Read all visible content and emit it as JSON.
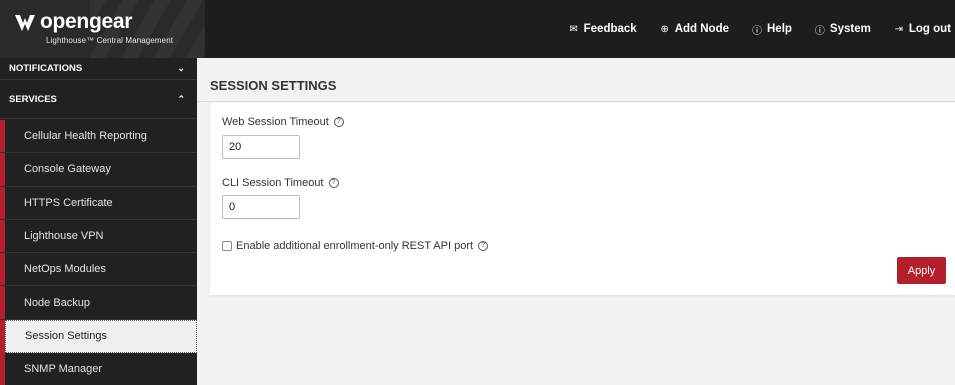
{
  "brand": {
    "name": "opengear",
    "subtitle": "Lighthouse™ Central Management"
  },
  "topnav": [
    {
      "label": "Feedback",
      "icon": "envelope-icon"
    },
    {
      "label": "Add Node",
      "icon": "plus-circle-icon"
    },
    {
      "label": "Help",
      "icon": "help-circle-icon"
    },
    {
      "label": "System",
      "icon": "info-circle-icon"
    },
    {
      "label": "Log out",
      "icon": "logout-icon"
    }
  ],
  "sidebar": {
    "notifications": "NOTIFICATIONS",
    "services": "SERVICES",
    "items": [
      {
        "label": "Cellular Health Reporting"
      },
      {
        "label": "Console Gateway"
      },
      {
        "label": "HTTPS Certificate"
      },
      {
        "label": "Lighthouse VPN"
      },
      {
        "label": "NetOps Modules"
      },
      {
        "label": "Node Backup"
      },
      {
        "label": "Session Settings",
        "active": true
      },
      {
        "label": "SNMP Manager"
      }
    ]
  },
  "page": {
    "title": "SESSION SETTINGS",
    "web_timeout_label": "Web Session Timeout",
    "web_timeout_value": "20",
    "cli_timeout_label": "CLI Session Timeout",
    "cli_timeout_value": "0",
    "rest_api_label": "Enable additional enrollment-only REST API port",
    "rest_api_checked": false,
    "apply_label": "Apply"
  },
  "colors": {
    "accent": "#b3202b",
    "header_bg": "#1d1d1d",
    "sidebar_bg": "#212121"
  }
}
